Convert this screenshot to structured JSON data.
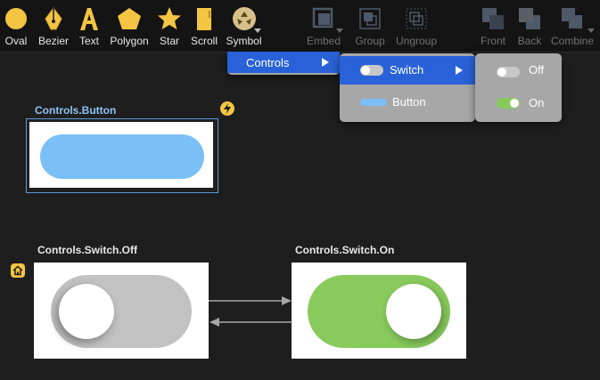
{
  "toolbar": {
    "items": [
      {
        "label": "Oval",
        "icon": "oval-icon"
      },
      {
        "label": "Bezier",
        "icon": "bezier-pen-icon"
      },
      {
        "label": "Text",
        "icon": "text-icon"
      },
      {
        "label": "Polygon",
        "icon": "polygon-icon"
      },
      {
        "label": "Star",
        "icon": "star-icon"
      },
      {
        "label": "Scroll",
        "icon": "scroll-icon"
      },
      {
        "label": "Symbol",
        "icon": "symbol-icon"
      },
      {
        "label": "Embed",
        "icon": "embed-icon"
      },
      {
        "label": "Group",
        "icon": "group-icon"
      },
      {
        "label": "Ungroup",
        "icon": "ungroup-icon"
      },
      {
        "label": "Front",
        "icon": "bring-front-icon"
      },
      {
        "label": "Back",
        "icon": "send-back-icon"
      },
      {
        "label": "Combine",
        "icon": "combine-icon"
      }
    ]
  },
  "menu": {
    "level1": {
      "label": "Controls"
    },
    "level2": [
      {
        "label": "Switch"
      },
      {
        "label": "Button"
      }
    ],
    "level3": [
      {
        "label": "Off"
      },
      {
        "label": "On"
      }
    ]
  },
  "canvas": {
    "button_frame": {
      "title": "Controls.Button"
    },
    "switch_off_frame": {
      "title": "Controls.Switch.Off"
    },
    "switch_on_frame": {
      "title": "Controls.Switch.On"
    }
  },
  "colors": {
    "accent": "#2962d8",
    "yellow": "#f4c542",
    "button_blue": "#7bbff7",
    "switch_green": "#88cb5c",
    "switch_grey": "#c2c2c2",
    "selection_blue": "#5b9ad8"
  }
}
